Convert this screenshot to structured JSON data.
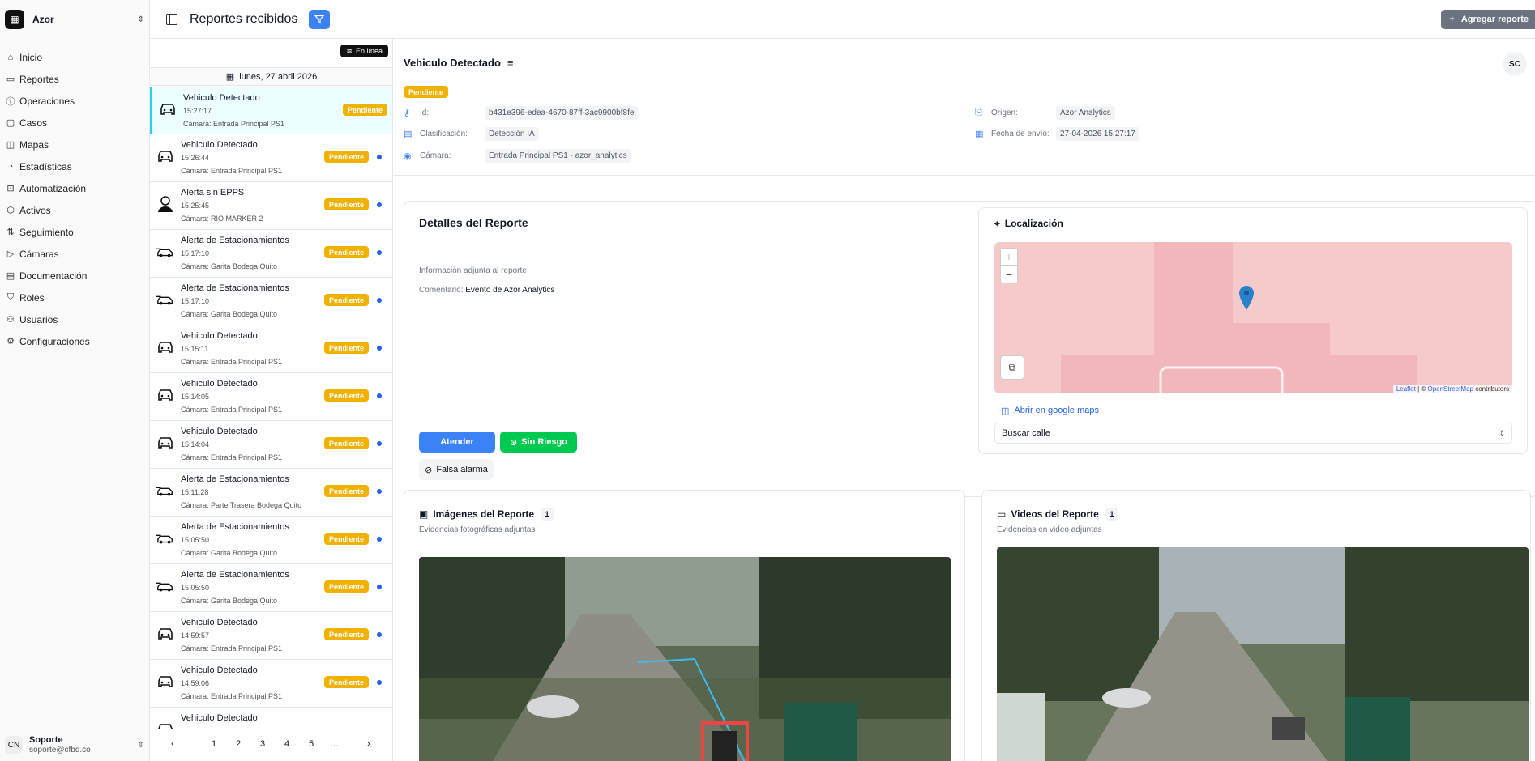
{
  "workspace": {
    "name": "Azor",
    "logo_icon": "grid-icon"
  },
  "nav": [
    {
      "label": "Inicio",
      "icon": "home-icon"
    },
    {
      "label": "Reportes",
      "icon": "report-icon"
    },
    {
      "label": "Operaciones",
      "icon": "alert-icon"
    },
    {
      "label": "Casos",
      "icon": "folder-icon"
    },
    {
      "label": "Mapas",
      "icon": "map-icon"
    },
    {
      "label": "Estadísticas",
      "icon": "chart-icon"
    },
    {
      "label": "Automatización",
      "icon": "robot-icon"
    },
    {
      "label": "Activos",
      "icon": "box-icon"
    },
    {
      "label": "Seguimiento",
      "icon": "sort-icon"
    },
    {
      "label": "Cámaras",
      "icon": "camera-icon"
    },
    {
      "label": "Documentación",
      "icon": "book-icon"
    },
    {
      "label": "Roles",
      "icon": "shield-icon"
    },
    {
      "label": "Usuarios",
      "icon": "users-icon"
    },
    {
      "label": "Configuraciones",
      "icon": "gear-icon"
    }
  ],
  "user": {
    "initials": "CN",
    "name": "Soporte",
    "email": "soporte@cfbd.co"
  },
  "header": {
    "title": "Reportes recibidos",
    "add_label": "Agregar reporte"
  },
  "list": {
    "status_label": "En línea",
    "date": "lunes, 27 abril 2026",
    "items": [
      {
        "title": "Vehiculo Detectado",
        "time": "15:27:17",
        "camera": "Cámara: Entrada Principal PS1",
        "status": "Pendiente",
        "kind": "car"
      },
      {
        "title": "Vehiculo Detectado",
        "time": "15:26:44",
        "camera": "Cámara: Entrada Principal PS1",
        "status": "Pendiente",
        "kind": "car"
      },
      {
        "title": "Alerta sin EPPS",
        "time": "15:25:45",
        "camera": "Cámara: RIO MARKER 2",
        "status": "Pendiente",
        "kind": "person"
      },
      {
        "title": "Alerta de Estacionamientos",
        "time": "15:17:10",
        "camera": "Cámara: Garita Bodega Quito",
        "status": "Pendiente",
        "kind": "parking"
      },
      {
        "title": "Alerta de Estacionamientos",
        "time": "15:17:10",
        "camera": "Cámara: Garita Bodega Quito",
        "status": "Pendiente",
        "kind": "parking"
      },
      {
        "title": "Vehiculo Detectado",
        "time": "15:15:11",
        "camera": "Cámara: Entrada Principal PS1",
        "status": "Pendiente",
        "kind": "car"
      },
      {
        "title": "Vehiculo Detectado",
        "time": "15:14:05",
        "camera": "Cámara: Entrada Principal PS1",
        "status": "Pendiente",
        "kind": "car"
      },
      {
        "title": "Vehiculo Detectado",
        "time": "15:14:04",
        "camera": "Cámara: Entrada Principal PS1",
        "status": "Pendiente",
        "kind": "car"
      },
      {
        "title": "Alerta de Estacionamientos",
        "time": "15:11:28",
        "camera": "Cámara: Parte Trasera Bodega Quito",
        "status": "Pendiente",
        "kind": "parking"
      },
      {
        "title": "Alerta de Estacionamientos",
        "time": "15:05:50",
        "camera": "Cámara: Garita Bodega Quito",
        "status": "Pendiente",
        "kind": "parking"
      },
      {
        "title": "Alerta de Estacionamientos",
        "time": "15:05:50",
        "camera": "Cámara: Garita Bodega Quito",
        "status": "Pendiente",
        "kind": "parking"
      },
      {
        "title": "Vehiculo Detectado",
        "time": "14:59:57",
        "camera": "Cámara: Entrada Principal PS1",
        "status": "Pendiente",
        "kind": "car"
      },
      {
        "title": "Vehiculo Detectado",
        "time": "14:59:06",
        "camera": "Cámara: Entrada Principal PS1",
        "status": "Pendiente",
        "kind": "car"
      },
      {
        "title": "Vehiculo Detectado",
        "time": "",
        "camera": "",
        "status": "",
        "kind": "car"
      }
    ],
    "pages": [
      "1",
      "2",
      "3",
      "4",
      "5",
      "…"
    ]
  },
  "detail": {
    "title": "Vehiculo Detectado",
    "avatar": "SC",
    "status": "Pendiente",
    "id_label": "Id:",
    "id_value": "b431e396-edea-4670-87ff-3ac9900bf8fe",
    "class_label": "Clasificación:",
    "class_value": "Detección IA",
    "camera_label": "Cámara:",
    "camera_value": "Entrada Principal PS1 - azor_analytics",
    "origin_label": "Origen:",
    "origin_value": "Azor Analytics",
    "date_label": "Fecha de envío:",
    "date_value": "27-04-2026 15:27:17"
  },
  "report": {
    "title": "Detalles del Reporte",
    "subtitle": "Información adjunta al reporte",
    "comment_label": "Comentario:",
    "comment_value": "Evento de Azor Analytics",
    "attend": "Atender",
    "no_risk": "Sin Riesgo",
    "false_alarm": "Falsa alarma"
  },
  "location": {
    "title": "Localización",
    "maps_link": "Abrir en google maps",
    "street_placeholder": "Buscar calle",
    "attribution_leaflet": "Leaflet",
    "attribution_osm": "OpenStreetMap",
    "attribution_tail": "contributors"
  },
  "images": {
    "title": "Imágenes del Reporte",
    "count": "1",
    "subtitle": "Evidencias fotográficas adjuntas"
  },
  "videos": {
    "title": "Videos del Reporte",
    "count": "1",
    "subtitle": "Evidencias en video adjuntas"
  },
  "colors": {
    "accent": "#3b82f6",
    "pending": "#f0b100",
    "success": "#00c951",
    "selected": "#22d3ee"
  }
}
